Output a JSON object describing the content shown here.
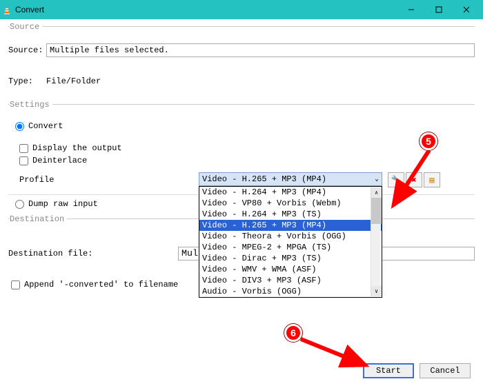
{
  "window": {
    "title": "Convert"
  },
  "source": {
    "legend": "Source",
    "label": "Source:",
    "value": "Multiple files selected.",
    "type_label": "Type:",
    "type_value": "File/Folder"
  },
  "settings": {
    "legend": "Settings",
    "convert_label": "Convert",
    "display_label": "Display the output",
    "deinterlace_label": "Deinterlace",
    "profile_label": "Profile",
    "profile_selected": "Video - H.265 + MP3 (MP4)",
    "profile_options": [
      "Video - H.264 + MP3 (MP4)",
      "Video - VP80 + Vorbis (Webm)",
      "Video - H.264 + MP3 (TS)",
      "Video - H.265 + MP3 (MP4)",
      "Video - Theora + Vorbis (OGG)",
      "Video - MPEG-2 + MPGA (TS)",
      "Video - Dirac + MP3 (TS)",
      "Video - WMV + WMA (ASF)",
      "Video - DIV3 + MP3 (ASF)",
      "Audio - Vorbis (OGG)"
    ],
    "profile_selected_index": 3,
    "dump_label": "Dump raw input",
    "icon_tool": "wrench-icon",
    "icon_delete": "x-icon",
    "icon_new": "new-profile-icon"
  },
  "destination": {
    "legend": "Destination",
    "label": "Destination file:",
    "value": "Multiple Fil",
    "append_label": "Append '-converted' to filename"
  },
  "buttons": {
    "start": "Start",
    "cancel": "Cancel"
  },
  "annotations": {
    "badge5": "5",
    "badge6": "6"
  }
}
